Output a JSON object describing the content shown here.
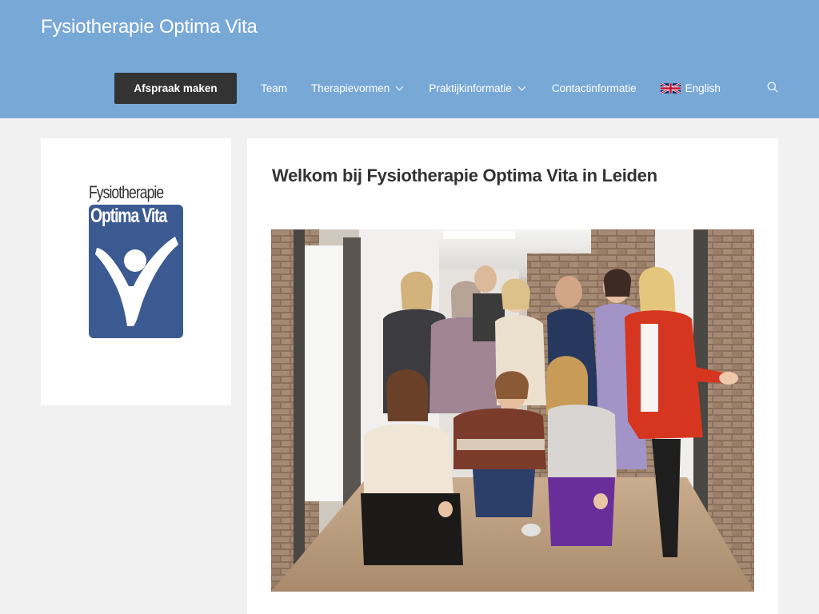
{
  "header": {
    "site_title": "Fysiotherapie Optima Vita",
    "cta_label": "Afspraak maken",
    "nav": {
      "team": "Team",
      "therapievormen": "Therapievormen",
      "praktijkinformatie": "Praktijkinformatie",
      "contact": "Contactinformatie",
      "language": "English"
    },
    "icons": {
      "search": "search-icon",
      "flag": "uk-flag-icon",
      "dropdown": "chevron-down-icon"
    }
  },
  "sidebar": {
    "logo_line1": "Fysiotherapie",
    "logo_line2": "Optima Vita"
  },
  "main": {
    "title": "Welkom bij Fysiotherapie Optima Vita in Leiden"
  },
  "colors": {
    "header_bg": "#78a8d6",
    "cta_bg": "#333333",
    "logo_blue": "#3b5a92",
    "page_bg": "#f1f1f1"
  }
}
